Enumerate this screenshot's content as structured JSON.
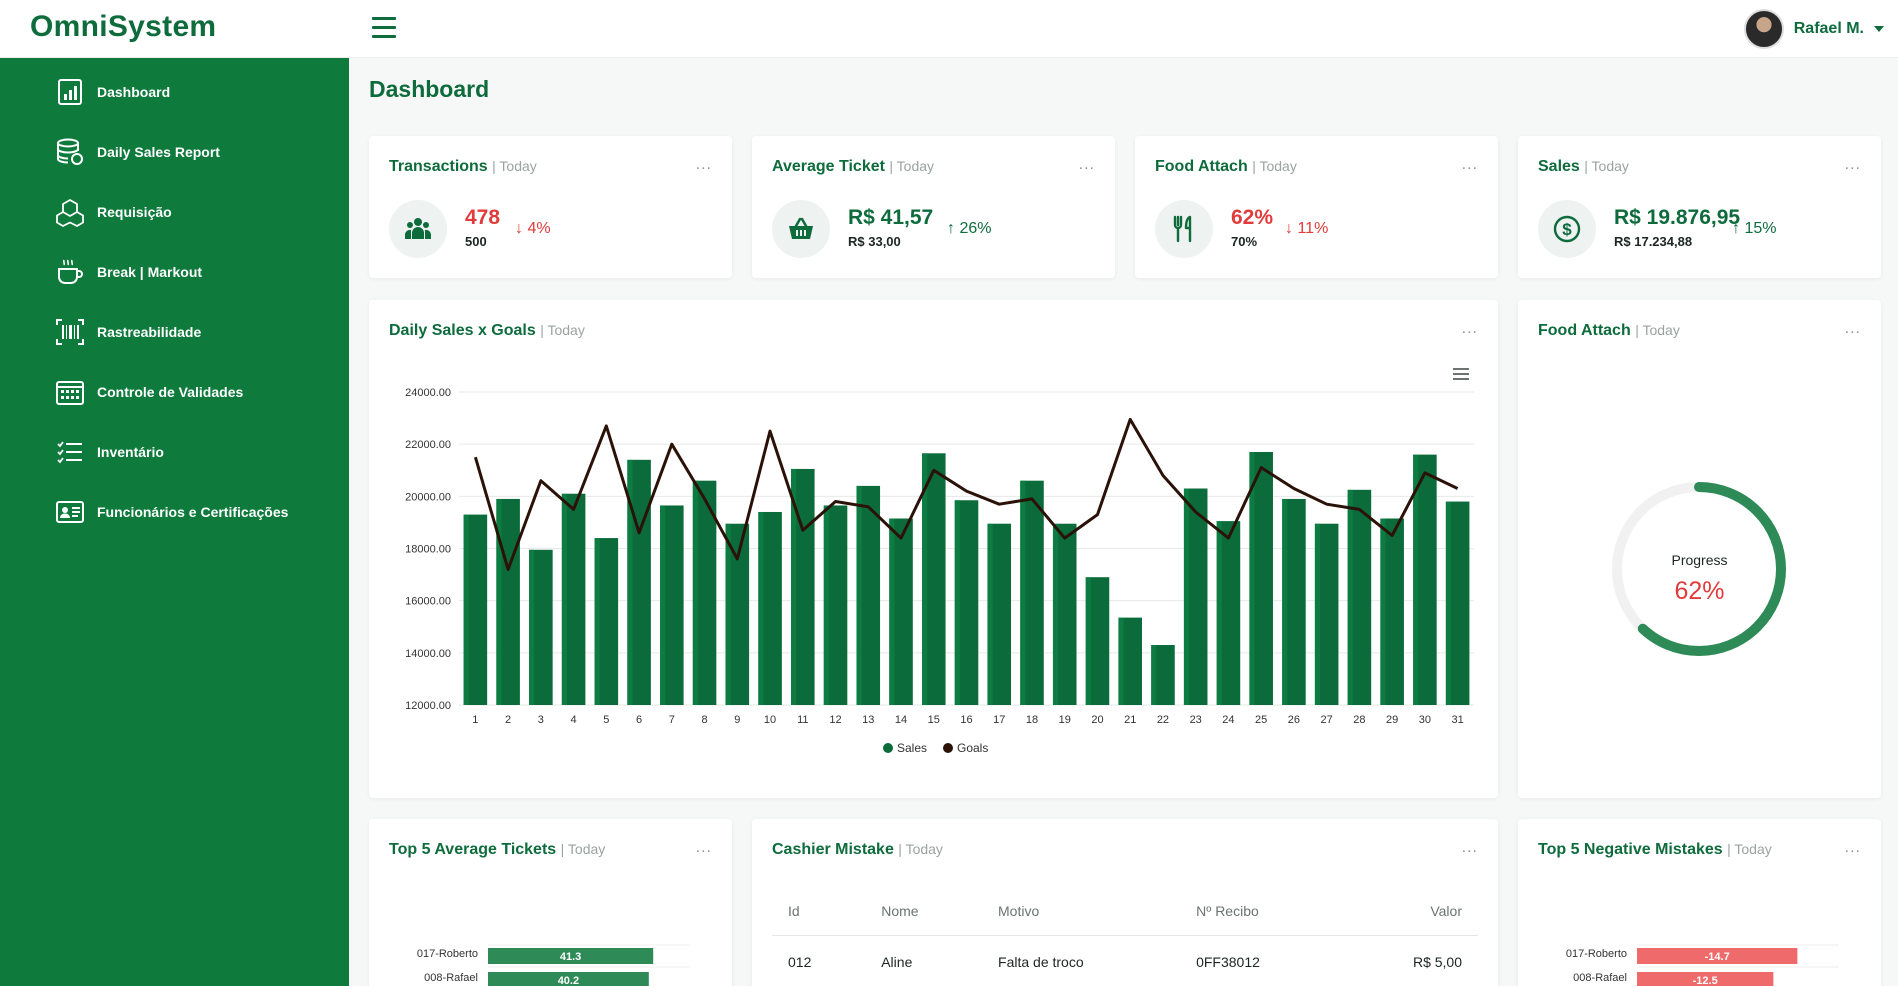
{
  "app": {
    "name": "OmniSystem"
  },
  "user": {
    "name": "Rafael M."
  },
  "sidebar": {
    "items": [
      {
        "label": "Dashboard",
        "icon": "bar-chart-icon"
      },
      {
        "label": "Daily Sales Report",
        "icon": "database-icon"
      },
      {
        "label": "Requisição",
        "icon": "boxes-icon"
      },
      {
        "label": "Break | Markout",
        "icon": "coffee-cup-icon"
      },
      {
        "label": "Rastreabilidade",
        "icon": "barcode-scan-icon"
      },
      {
        "label": "Controle de Validades",
        "icon": "calendar-icon"
      },
      {
        "label": "Inventário",
        "icon": "checklist-icon"
      },
      {
        "label": "Funcionários e Certificações",
        "icon": "id-card-icon"
      }
    ]
  },
  "page": {
    "title": "Dashboard"
  },
  "today_label": "| Today",
  "more_label": "...",
  "kpis": [
    {
      "title": "Transactions",
      "value": "478",
      "sub": "500",
      "delta": "4%",
      "direction": "down",
      "icon": "people-icon"
    },
    {
      "title": "Average Ticket",
      "value": "R$ 41,57",
      "sub": "R$ 33,00",
      "delta": "26%",
      "direction": "up",
      "icon": "basket-icon"
    },
    {
      "title": "Food Attach",
      "value": "62%",
      "sub": "70%",
      "delta": "11%",
      "direction": "down",
      "icon": "fork-knife-icon"
    },
    {
      "title": "Sales",
      "value": "R$ 19.876,95",
      "sub": "R$ 17.234,88",
      "delta": "15%",
      "direction": "up",
      "icon": "dollar-icon"
    }
  ],
  "daily_chart": {
    "title": "Daily Sales x Goals",
    "menu_icon": "hamburger-menu-icon"
  },
  "food_attach_gauge": {
    "title": "Food Attach",
    "label": "Progress",
    "value_text": "62%",
    "value": 0.62
  },
  "top5_avg": {
    "title": "Top 5 Average Tickets"
  },
  "cashier": {
    "title": "Cashier Mistake",
    "columns": [
      "Id",
      "Nome",
      "Motivo",
      "Nº Recibo",
      "Valor"
    ],
    "rows": [
      [
        "012",
        "Aline",
        "Falta de troco",
        "0FF38012",
        "R$ 5,00"
      ]
    ]
  },
  "top5_neg": {
    "title": "Top 5 Negative Mistakes"
  },
  "colors": {
    "brand": "#0e7a3c",
    "sales_bar": "#0b6b3a",
    "goals_line": "#2b1208",
    "negative": "#e13b3b",
    "negative_bar": "#ef6a6a",
    "positive_bar": "#2e8b57"
  },
  "chart_data": [
    {
      "type": "bar",
      "title": "Daily Sales x Goals",
      "categories": [
        "1",
        "2",
        "3",
        "4",
        "5",
        "6",
        "7",
        "8",
        "9",
        "10",
        "11",
        "12",
        "13",
        "14",
        "15",
        "16",
        "17",
        "18",
        "19",
        "20",
        "21",
        "22",
        "23",
        "24",
        "25",
        "26",
        "27",
        "28",
        "29",
        "30",
        "31"
      ],
      "series": [
        {
          "name": "Sales",
          "type": "bar",
          "values": [
            19300,
            19900,
            17950,
            20100,
            18400,
            21400,
            19650,
            20600,
            18950,
            19400,
            21050,
            19650,
            20400,
            19150,
            21650,
            19850,
            18950,
            20600,
            18950,
            16900,
            15350,
            14300,
            20300,
            19050,
            21700,
            19900,
            18950,
            20250,
            19150,
            21600,
            19800
          ]
        },
        {
          "name": "Goals",
          "type": "line",
          "values": [
            21500,
            17200,
            20600,
            19500,
            22700,
            18600,
            22000,
            19900,
            17600,
            22500,
            18700,
            19800,
            19600,
            18400,
            21000,
            20200,
            19700,
            19900,
            18400,
            19300,
            22950,
            20800,
            19400,
            18400,
            21100,
            20300,
            19700,
            19500,
            18500,
            20900,
            20300
          ]
        }
      ],
      "ylim": [
        12000,
        24000
      ],
      "yticks": [
        "24000.00",
        "22000.00",
        "20000.00",
        "18000.00",
        "16000.00",
        "14000.00",
        "12000.00"
      ],
      "legend": "bottom"
    },
    {
      "type": "bar",
      "title": "Top 5 Average Tickets",
      "categories": [
        "017-Roberto",
        "008-Rafael"
      ],
      "values": [
        41.3,
        40.2
      ]
    },
    {
      "type": "bar",
      "title": "Top 5 Negative Mistakes",
      "categories": [
        "017-Roberto",
        "008-Rafael"
      ],
      "values": [
        -14.7,
        -12.5
      ]
    }
  ]
}
